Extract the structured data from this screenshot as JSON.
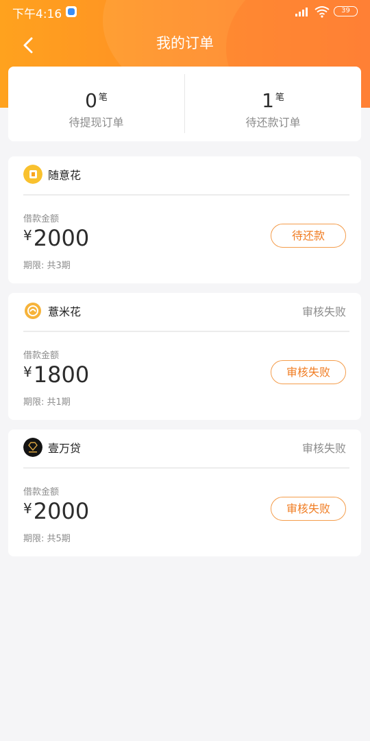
{
  "status_bar": {
    "time": "下午4:16",
    "battery": "39"
  },
  "header": {
    "title": "我的订单"
  },
  "summary": [
    {
      "count": "0",
      "unit": "笔",
      "label": "待提现订单"
    },
    {
      "count": "1",
      "unit": "笔",
      "label": "待还款订单"
    }
  ],
  "orders": [
    {
      "name": "随意花",
      "status": "",
      "amount_label": "借款金额",
      "currency": "¥",
      "amount": "2000",
      "term": "期限: 共3期",
      "action": "待还款",
      "logo_color": "#f9c12e"
    },
    {
      "name": "薏米花",
      "status": "审核失败",
      "amount_label": "借款金额",
      "currency": "¥",
      "amount": "1800",
      "term": "期限: 共1期",
      "action": "审核失败",
      "logo_color": "#f6b33a"
    },
    {
      "name": "壹万贷",
      "status": "审核失败",
      "amount_label": "借款金额",
      "currency": "¥",
      "amount": "2000",
      "term": "期限: 共5期",
      "action": "审核失败",
      "logo_color": "#141414"
    }
  ],
  "colors": {
    "accent": "#ff8c26",
    "action_text": "#f07c22",
    "action_border": "#f49c4a"
  }
}
